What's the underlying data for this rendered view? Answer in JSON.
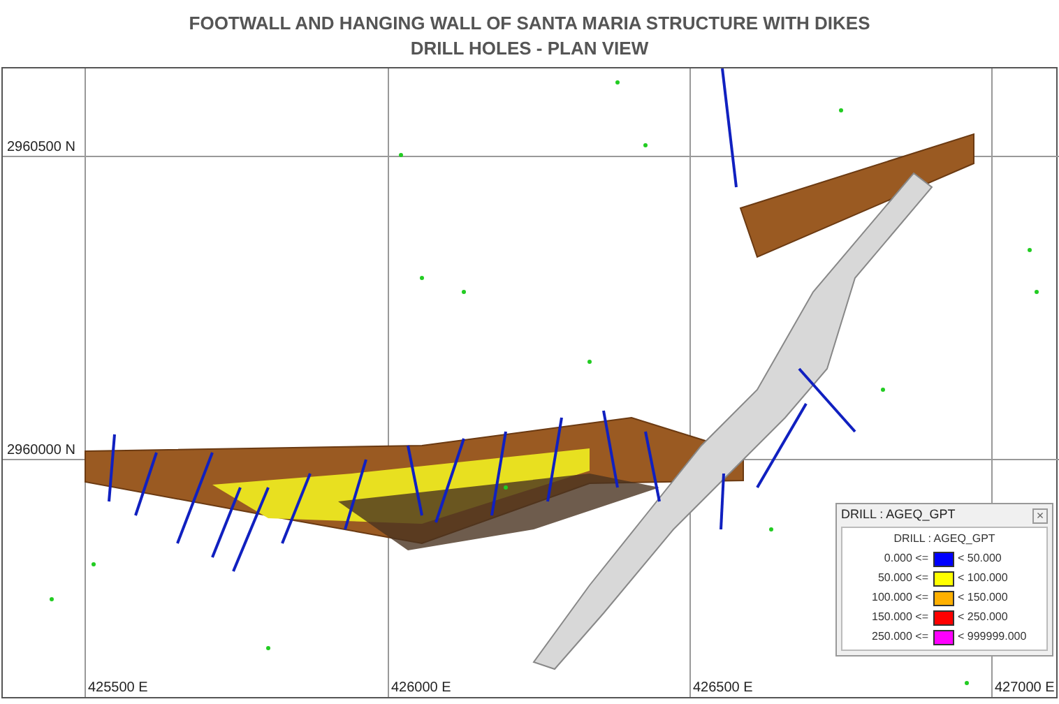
{
  "title": {
    "line_1": "FOOTWALL AND HANGING WALL OF SANTA MARIA STRUCTURE WITH DIKES",
    "line_2": "DRILL HOLES - PLAN VIEW"
  },
  "map": {
    "northing_labels": [
      "2960500 N",
      "2960000 N"
    ],
    "easting_labels": [
      "425500 E",
      "426000 E",
      "426500 E",
      "427000 E"
    ]
  },
  "legend": {
    "window_title": "DRILL : AGEQ_GPT",
    "heading": "DRILL : AGEQ_GPT",
    "close": "×",
    "entries": [
      {
        "lower": "0.000 <=",
        "upper": "< 50.000",
        "color": "#0000ff"
      },
      {
        "lower": "50.000 <=",
        "upper": "< 100.000",
        "color": "#ffff00"
      },
      {
        "lower": "100.000 <=",
        "upper": "< 150.000",
        "color": "#ffb000"
      },
      {
        "lower": "150.000 <=",
        "upper": "< 250.000",
        "color": "#ff0000"
      },
      {
        "lower": "250.000 <=",
        "upper": "< 999999.000",
        "color": "#ff00ff"
      }
    ]
  }
}
